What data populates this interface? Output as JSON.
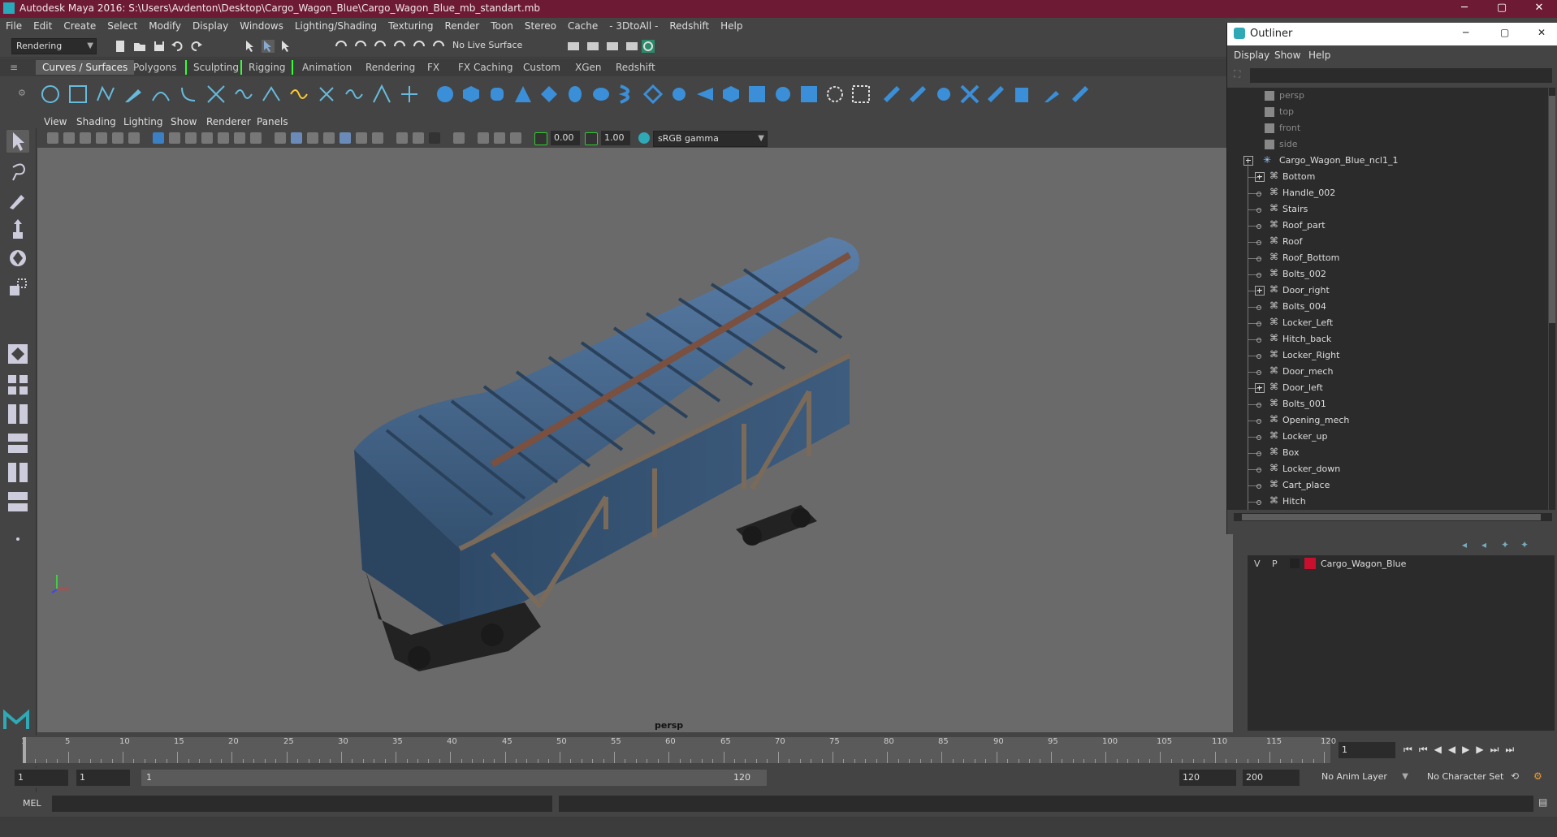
{
  "window": {
    "title": "Autodesk Maya 2016: S:\\Users\\Avdenton\\Desktop\\Cargo_Wagon_Blue\\Cargo_Wagon_Blue_mb_standart.mb",
    "min": "─",
    "max": "▢",
    "close": "✕"
  },
  "menu": [
    "File",
    "Edit",
    "Create",
    "Select",
    "Modify",
    "Display",
    "Windows",
    "Lighting/Shading",
    "Texturing",
    "Render",
    "Toon",
    "Stereo",
    "Cache",
    "- 3DtoAll -",
    "Redshift",
    "Help"
  ],
  "toolbar": {
    "mode": "Rendering",
    "live_surface": "No Live Surface"
  },
  "shelf_tabs": [
    "Curves / Surfaces",
    "Polygons",
    "Sculpting",
    "Rigging",
    "Animation",
    "Rendering",
    "FX",
    "FX Caching",
    "Custom",
    "XGen",
    "Redshift"
  ],
  "shelf_active": "Curves / Surfaces",
  "viewport": {
    "menu": [
      "View",
      "Shading",
      "Lighting",
      "Show",
      "Renderer",
      "Panels"
    ],
    "exposure": "0.00",
    "gamma": "1.00",
    "color_space": "sRGB gamma",
    "camera_label": "persp"
  },
  "outliner": {
    "title": "Outliner",
    "menu": [
      "Display",
      "Show",
      "Help"
    ],
    "cameras": [
      "persp",
      "top",
      "front",
      "side"
    ],
    "root": "Cargo_Wagon_Blue_ncl1_1",
    "children": [
      "Bottom",
      "Handle_002",
      "Stairs",
      "Roof_part",
      "Roof",
      "Roof_Bottom",
      "Bolts_002",
      "Door_right",
      "Bolts_004",
      "Locker_Left",
      "Hitch_back",
      "Locker_Right",
      "Door_mech",
      "Door_left",
      "Bolts_001",
      "Opening_mech",
      "Locker_up",
      "Box",
      "Locker_down",
      "Cart_place",
      "Hitch"
    ],
    "expandable": [
      "Bottom",
      "Door_right",
      "Door_left"
    ]
  },
  "layers": {
    "v": "V",
    "p": "P",
    "name": "Cargo_Wagon_Blue",
    "color": "#c8102e"
  },
  "timeline": {
    "ticks": [
      1,
      5,
      10,
      15,
      20,
      25,
      30,
      35,
      40,
      45,
      50,
      55,
      60,
      65,
      70,
      75,
      80,
      85,
      90,
      95,
      100,
      105,
      110,
      115,
      120
    ],
    "current_frame": "1"
  },
  "range": {
    "start": "1",
    "playback_start": "1",
    "slider_start": "1",
    "slider_end": "120",
    "playback_end": "120",
    "end": "200",
    "anim_layer": "No Anim Layer",
    "char_set": "No Character Set"
  },
  "cmdline": {
    "lang": "MEL"
  },
  "colors": {
    "title_bar": "#6d1b34",
    "accent": "#2fa9b5",
    "wagon": "#3d5a7a"
  }
}
